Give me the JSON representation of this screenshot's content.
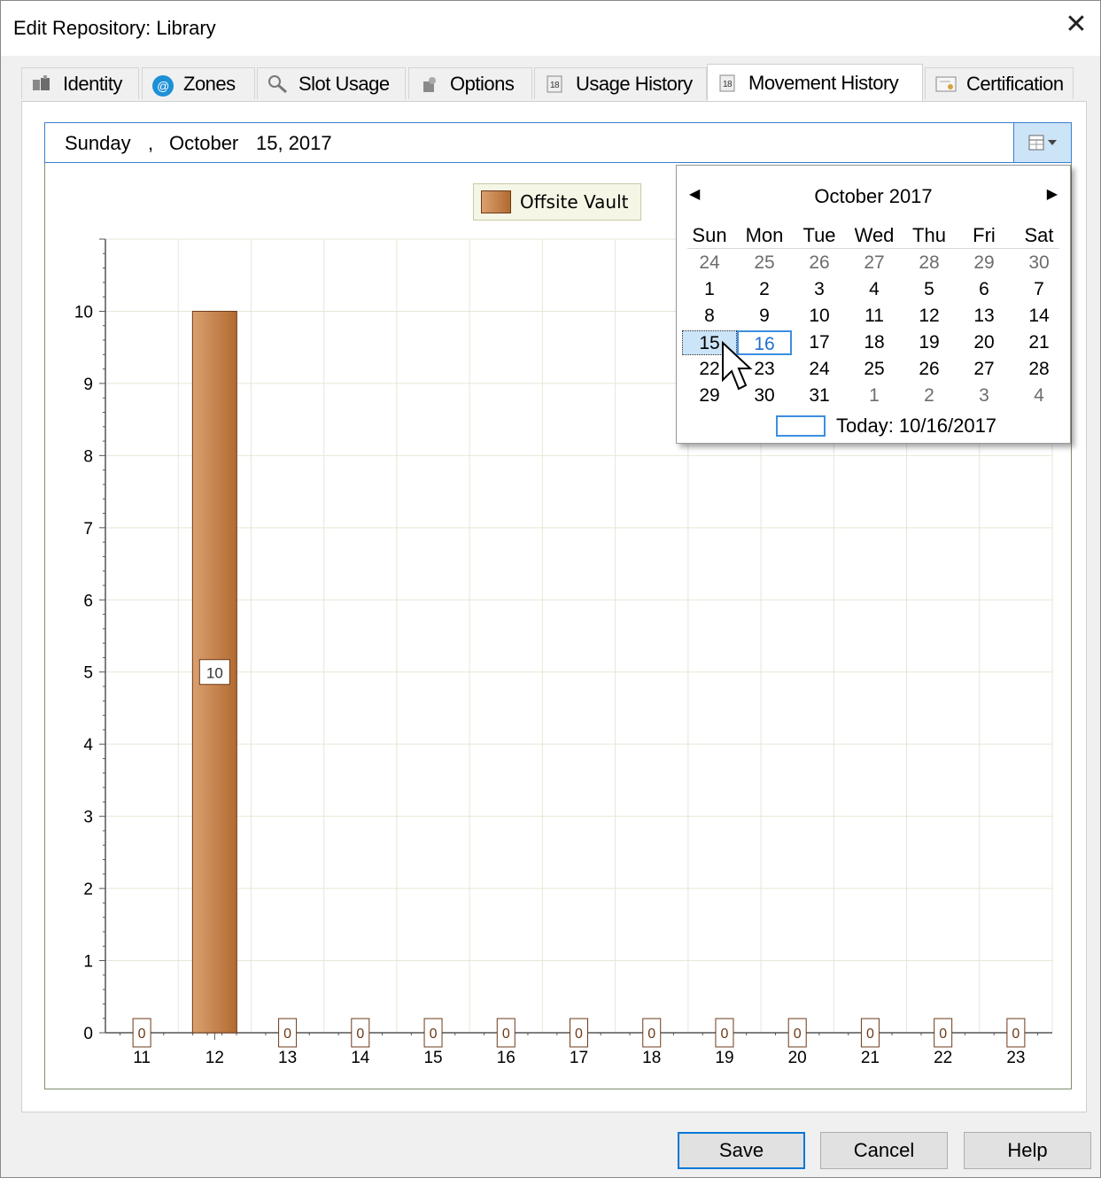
{
  "window": {
    "title": "Edit Repository: Library",
    "close_icon": "close-icon"
  },
  "tabs": [
    {
      "label": "Identity",
      "icon": "identity-icon"
    },
    {
      "label": "Zones",
      "icon": "at-sign-icon"
    },
    {
      "label": "Slot Usage",
      "icon": "magnifier-icon"
    },
    {
      "label": "Options",
      "icon": "options-icon"
    },
    {
      "label": "Usage History",
      "icon": "calendar-page-icon"
    },
    {
      "label": "Movement History",
      "icon": "calendar-page-icon",
      "active": true
    },
    {
      "label": "Certification",
      "icon": "certificate-icon"
    }
  ],
  "datepicker": {
    "weekday": "Sunday",
    "sep": ",",
    "month": "October",
    "day_year": "15, 2017",
    "dropdown_icon": "calendar-dropdown-icon"
  },
  "calendar": {
    "title": "October 2017",
    "prev_icon": "prev-month-arrow",
    "next_icon": "next-month-arrow",
    "weekdays": [
      "Sun",
      "Mon",
      "Tue",
      "Wed",
      "Thu",
      "Fri",
      "Sat"
    ],
    "weeks": [
      [
        "24",
        "25",
        "26",
        "27",
        "28",
        "29",
        "30"
      ],
      [
        "1",
        "2",
        "3",
        "4",
        "5",
        "6",
        "7"
      ],
      [
        "8",
        "9",
        "10",
        "11",
        "12",
        "13",
        "14"
      ],
      [
        "15",
        "16",
        "17",
        "18",
        "19",
        "20",
        "21"
      ],
      [
        "22",
        "23",
        "24",
        "25",
        "26",
        "27",
        "28"
      ],
      [
        "29",
        "30",
        "31",
        "1",
        "2",
        "3",
        "4"
      ]
    ],
    "selected": "15",
    "today": "16",
    "today_text": "Today: 10/16/2017"
  },
  "chart_data": {
    "type": "bar",
    "categories": [
      "11",
      "12",
      "13",
      "14",
      "15",
      "16",
      "17",
      "18",
      "19",
      "20",
      "21",
      "22",
      "23"
    ],
    "series": [
      {
        "name": "Offsite Vault",
        "values": [
          0,
          10,
          0,
          0,
          0,
          0,
          0,
          0,
          0,
          0,
          0,
          0,
          0
        ]
      }
    ],
    "ylim": [
      0,
      11
    ],
    "yticks": [
      "0",
      "1",
      "2",
      "3",
      "4",
      "5",
      "6",
      "7",
      "8",
      "9",
      "10"
    ],
    "grid": true,
    "legend": "top-center",
    "data_labels": true,
    "colors": {
      "bar_light": "#dba070",
      "bar_dark": "#b26a30",
      "grid": "#e4e8d6",
      "axis": "#555555"
    }
  },
  "buttons": {
    "save": "Save",
    "cancel": "Cancel",
    "help": "Help"
  }
}
